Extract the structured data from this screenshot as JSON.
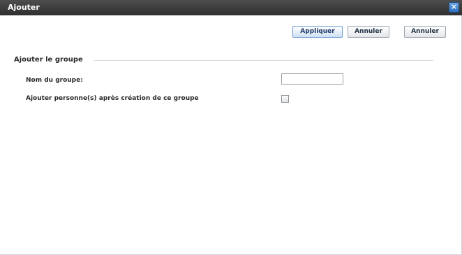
{
  "window": {
    "title": "Ajouter",
    "close_glyph": "×",
    "close_icon": "close-icon"
  },
  "toolbar": {
    "apply_label": "Appliquer",
    "cancel_label_1": "Annuler",
    "cancel_label_2": "Annuler"
  },
  "section": {
    "title": "Ajouter le groupe"
  },
  "form": {
    "group_name_label": "Nom du groupe:",
    "group_name_value": "",
    "add_people_label": "Ajouter personne(s) après création de ce groupe",
    "add_people_checked": false
  },
  "colors": {
    "titlebar": "#3a3a3a",
    "close_button": "#2b6fbf",
    "apply_button_border": "#6f9cd0"
  }
}
